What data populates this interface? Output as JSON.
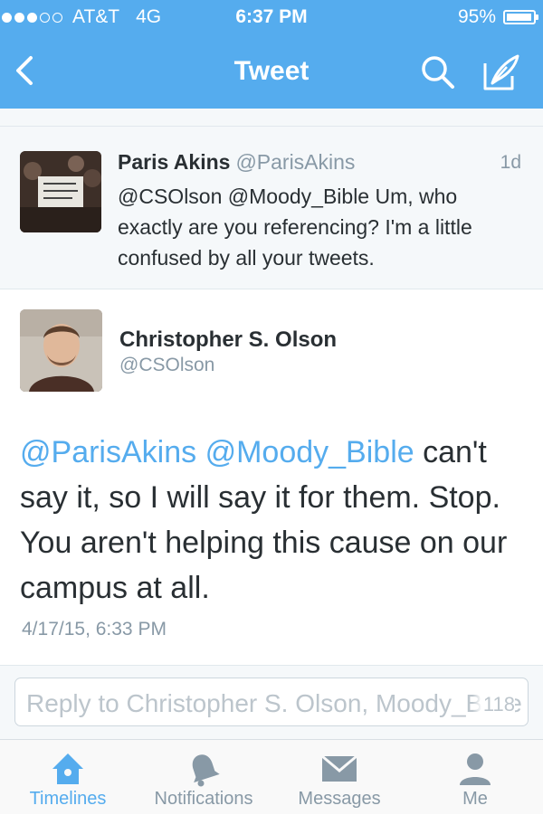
{
  "status_bar": {
    "carrier": "AT&T",
    "network": "4G",
    "time": "6:37 PM",
    "battery": "95%",
    "battery_level": 0.95,
    "signal_bars": 3,
    "signal_max": 5
  },
  "nav": {
    "title": "Tweet",
    "icons": [
      "back-arrow-icon",
      "search-icon",
      "compose-icon"
    ]
  },
  "parent_tweet": {
    "name": "Paris Akins",
    "handle": "@ParisAkins",
    "time": "1d",
    "text": "@CSOlson @Moody_Bible Um, who exactly are you referencing? I'm a little confused by all your tweets."
  },
  "main_tweet": {
    "name": "Christopher S. Olson",
    "handle": "@CSOlson",
    "mention_1": "@ParisAkins",
    "mention_2": "@Moody_Bible",
    "text_rest": " can't say it, so I will say it for them. Stop. You aren't helping this cause on our campus at all.",
    "date": "4/17/15, 6:33 PM"
  },
  "reply": {
    "placeholder": "Reply to Christopher S. Olson, Moody_Bible",
    "char_count": "118"
  },
  "tabs": [
    {
      "label": "Timelines",
      "icon": "home-icon",
      "active": true
    },
    {
      "label": "Notifications",
      "icon": "bell-icon",
      "active": false
    },
    {
      "label": "Messages",
      "icon": "envelope-icon",
      "active": false
    },
    {
      "label": "Me",
      "icon": "person-icon",
      "active": false
    }
  ],
  "colors": {
    "brand_blue": "#55acee",
    "secondary_text": "#8899a6",
    "background_gray": "#f5f8fa"
  }
}
